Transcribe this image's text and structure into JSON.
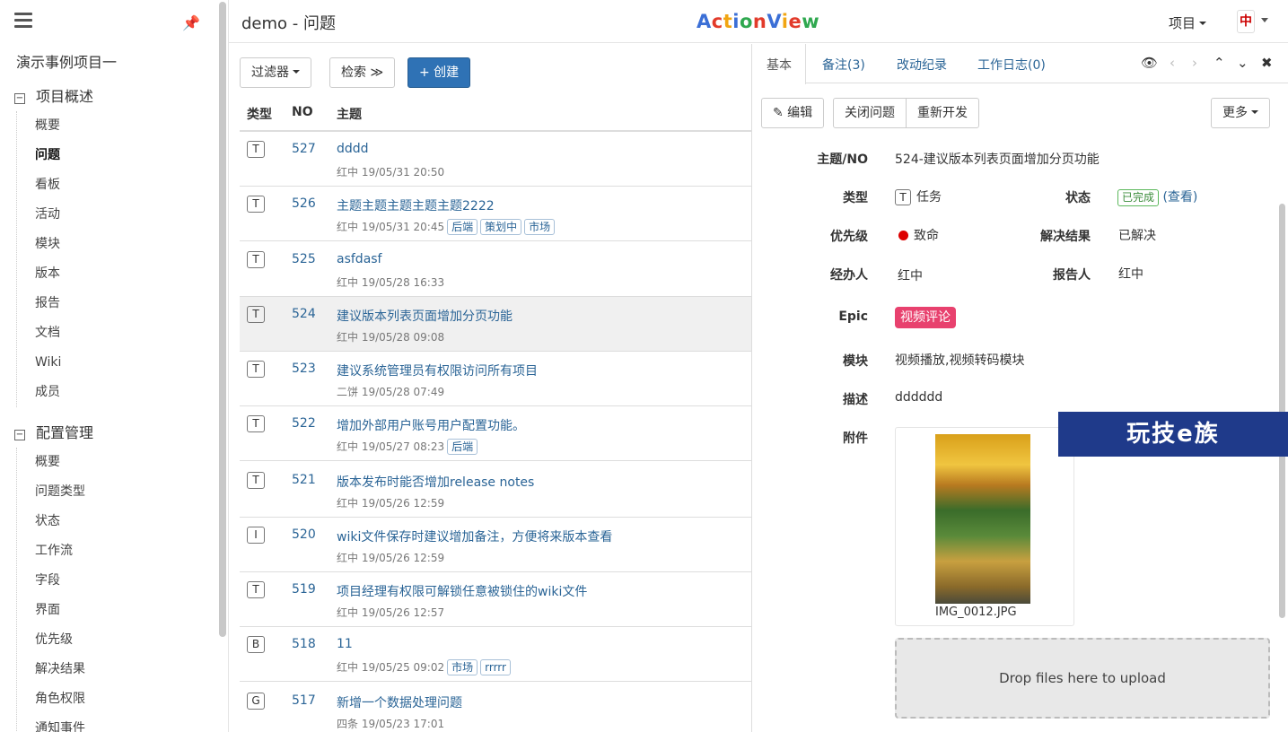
{
  "sidebar": {
    "project_title": "演示事例项目一",
    "group1": {
      "toggle": "−",
      "label": "项目概述"
    },
    "group1_items": [
      "概要",
      "问题",
      "看板",
      "活动",
      "模块",
      "版本",
      "报告",
      "文档",
      "Wiki",
      "成员"
    ],
    "group2": {
      "toggle": "−",
      "label": "配置管理"
    },
    "group2_items": [
      "概要",
      "问题类型",
      "状态",
      "工作流",
      "字段",
      "界面",
      "优先级",
      "解决结果",
      "角色权限",
      "通知事件"
    ],
    "pin_icon": "⚲"
  },
  "header": {
    "title": "demo - 问题",
    "logo": {
      "text": "ActionView",
      "colors": [
        "#3b6fd6",
        "#e23b2b",
        "#f1a512",
        "#3b6fd6",
        "#2fa84f",
        "#e23b2b",
        "#3b6fd6",
        "#f1a512",
        "#e23b2b",
        "#2fa84f"
      ]
    },
    "project_menu": "项目",
    "avatar_text": "中"
  },
  "toolbar": {
    "filter": "过滤器",
    "search": "检索 ≫",
    "create": "+ 创建"
  },
  "list": {
    "columns": {
      "type": "类型",
      "no": "NO",
      "subject": "主题"
    },
    "rows": [
      {
        "type": "T",
        "no": "527",
        "subject": "dddd",
        "meta": "红中  19/05/31 20:50",
        "labels": []
      },
      {
        "type": "T",
        "no": "526",
        "subject": "主题主题主题主题主题2222",
        "meta": "红中  19/05/31 20:45",
        "labels": [
          "后端",
          "策划中",
          "市场"
        ]
      },
      {
        "type": "T",
        "no": "525",
        "subject": "asfdasf",
        "meta": "红中  19/05/28 16:33",
        "labels": []
      },
      {
        "type": "T",
        "no": "524",
        "subject": "建议版本列表页面增加分页功能",
        "meta": "红中  19/05/28 09:08",
        "labels": []
      },
      {
        "type": "T",
        "no": "523",
        "subject": "建议系统管理员有权限访问所有项目",
        "meta": "二饼  19/05/28 07:49",
        "labels": []
      },
      {
        "type": "T",
        "no": "522",
        "subject": "增加外部用户账号用户配置功能。",
        "meta": "红中  19/05/27 08:23",
        "labels": [
          "后端"
        ]
      },
      {
        "type": "T",
        "no": "521",
        "subject": "版本发布时能否增加release notes",
        "meta": "红中  19/05/26 12:59",
        "labels": []
      },
      {
        "type": "I",
        "no": "520",
        "subject": "wiki文件保存时建议增加备注，方便将来版本查看",
        "meta": "红中  19/05/26 12:59",
        "labels": []
      },
      {
        "type": "T",
        "no": "519",
        "subject": "项目经理有权限可解锁任意被锁住的wiki文件",
        "meta": "红中  19/05/26 12:57",
        "labels": []
      },
      {
        "type": "B",
        "no": "518",
        "subject": "11",
        "meta": "红中  19/05/25 09:02",
        "labels": [
          "市场",
          "rrrrr"
        ]
      },
      {
        "type": "G",
        "no": "517",
        "subject": "新增一个数据处理问题",
        "meta": "四条  19/05/23 17:01",
        "labels": []
      }
    ]
  },
  "detail": {
    "tabs": [
      "基本",
      "备注(3)",
      "改动纪录",
      "工作日志(0)"
    ],
    "nav_icons": {
      "watch": "👁",
      "prev": "‹",
      "next": "›",
      "up": "⌃",
      "down": "⌄",
      "close": "✖"
    },
    "buttons": {
      "edit": "✎ 编辑",
      "close_issue": "关闭问题",
      "reopen": "重新开发",
      "more": "更多"
    },
    "fields": {
      "subject_label": "主题/NO",
      "subject_value": "524-建议版本列表页面增加分页功能",
      "type_label": "类型",
      "type_badge": "T",
      "type_value": "任务",
      "status_label": "状态",
      "status_value": "已完成",
      "status_link": "(查看)",
      "priority_label": "优先级",
      "priority_value": "致命",
      "resolution_label": "解决结果",
      "resolution_value": "已解决",
      "assignee_label": "经办人",
      "assignee_value": "红中",
      "reporter_label": "报告人",
      "reporter_value": "红中",
      "epic_label": "Epic",
      "epic_value": "视频评论",
      "module_label": "模块",
      "module_value": "视频播放,视频转码模块",
      "desc_label": "描述",
      "desc_value": "dddddd",
      "attach_label": "附件",
      "attach_name": "IMG_0012.JPG"
    },
    "dropzone": "Drop files here to upload"
  },
  "watermark": "玩技e族"
}
